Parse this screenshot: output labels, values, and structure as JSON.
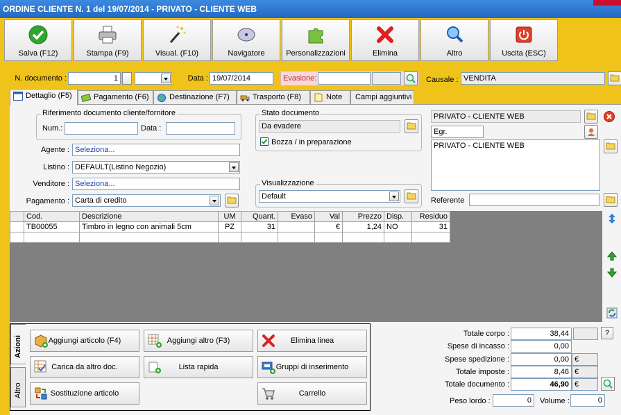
{
  "window": {
    "title": "ORDINE CLIENTE N. 1 del 19/07/2014 - PRIVATO - CLIENTE WEB"
  },
  "toolbar": {
    "buttons": [
      {
        "label": "Salva (F12)",
        "icon": "check-icon"
      },
      {
        "label": "Stampa (F9)",
        "icon": "printer-icon"
      },
      {
        "label": "Visual. (F10)",
        "icon": "magic-wand-icon"
      },
      {
        "label": "Navigatore",
        "icon": "compass-icon"
      },
      {
        "label": "Personalizzazioni",
        "icon": "puzzle-icon"
      },
      {
        "label": "Elimina",
        "icon": "delete-x-icon"
      },
      {
        "label": "Altro",
        "icon": "magnifier-icon"
      },
      {
        "label": "Uscita (ESC)",
        "icon": "power-icon"
      }
    ]
  },
  "header": {
    "ndoc_label": "N. documento :",
    "ndoc_value": "1",
    "data_label": "Data :",
    "data_value": "19/07/2014",
    "evasione_label": "Evasione:",
    "evasione_value": "",
    "causale_label": "Causale :",
    "causale_value": "VENDITA"
  },
  "tabs": [
    {
      "label": "Dettaglio (F5)",
      "icon": "window-icon"
    },
    {
      "label": "Pagamento (F6)",
      "icon": "money-icon"
    },
    {
      "label": "Destinazione (F7)",
      "icon": "globe-icon"
    },
    {
      "label": "Trasporto (F8)",
      "icon": "truck-icon"
    },
    {
      "label": "Note",
      "icon": "note-icon"
    },
    {
      "label": "Campi aggiuntivi",
      "icon": ""
    }
  ],
  "riferimento": {
    "title": "Riferimento documento cliente/fornitore",
    "num_label": "Num.:",
    "num_value": "",
    "data_label": "Data :",
    "data_value": ""
  },
  "stato": {
    "title": "Stato documento",
    "value": "Da evadere",
    "bozza_label": "Bozza / in preparazione",
    "bozza_checked": true
  },
  "cliente": {
    "name": "PRIVATO - CLIENTE WEB",
    "egr": "Egr.",
    "address": "PRIVATO - CLIENTE WEB",
    "referente_label": "Referente",
    "referente_value": ""
  },
  "fields": {
    "agente_label": "Agente :",
    "agente_value": "Seleziona...",
    "listino_label": "Listino :",
    "listino_value": "DEFAULT(Listino Negozio)",
    "venditore_label": "Venditore :",
    "venditore_value": "Seleziona...",
    "pagamento_label": "Pagamento :",
    "pagamento_value": "Carta di credito",
    "visualizzazione_title": "Visualizzazione",
    "visualizzazione_value": "Default"
  },
  "grid": {
    "columns": [
      "Cod.",
      "Descrizione",
      "UM",
      "Quant.",
      "Evaso",
      "Val",
      "Prezzo",
      "Disp.",
      "Residuo"
    ],
    "rows": [
      [
        "TB00055",
        "Timbro in legno con animali 5cm",
        "PZ",
        "31",
        "",
        "€",
        "1,24",
        "NO",
        "31"
      ]
    ]
  },
  "actions": {
    "tab_azioni": "Azioni",
    "tab_altro": "Altro",
    "buttons": [
      {
        "label": "Aggiungi articolo (F4)",
        "icon": "add-item-icon"
      },
      {
        "label": "Aggiungi altro (F3)",
        "icon": "add-other-icon"
      },
      {
        "label": "Elimina linea",
        "icon": "delete-line-icon"
      },
      {
        "label": "Carica da altro doc.",
        "icon": "load-doc-icon"
      },
      {
        "label": "Lista rapida",
        "icon": "quick-list-icon"
      },
      {
        "label": "Gruppi di inserimento",
        "icon": "insert-group-icon"
      },
      {
        "label": "Sostituzione articolo",
        "icon": "replace-item-icon"
      },
      {
        "label": "Carrello",
        "icon": "cart-icon"
      }
    ]
  },
  "totals": {
    "corpo_label": "Totale corpo :",
    "corpo_value": "38,44",
    "help": "?",
    "incasso_label": "Spese di incasso :",
    "incasso_value": "0,00",
    "spedizione_label": "Spese spedizione :",
    "spedizione_value": "0,00",
    "imposte_label": "Totale imposte :",
    "imposte_value": "8,46",
    "documento_label": "Totale documento :",
    "documento_value": "46,90",
    "currency": "€",
    "peso_label": "Peso lordo :",
    "peso_value": "0",
    "volume_label": "Volume :",
    "volume_value": "0"
  }
}
